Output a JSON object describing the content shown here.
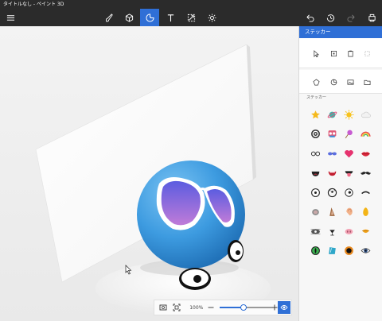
{
  "window": {
    "title": "タイトルなし - ペイント 3D"
  },
  "toolbar": {
    "left": [
      {
        "name": "menu-icon"
      }
    ],
    "tools": [
      {
        "name": "brushes-icon",
        "active": false
      },
      {
        "name": "3d-shapes-icon",
        "active": false
      },
      {
        "name": "stickers-icon",
        "active": true
      },
      {
        "name": "text-icon",
        "active": false
      },
      {
        "name": "effects-icon",
        "active": false
      },
      {
        "name": "canvas-icon",
        "active": false
      }
    ],
    "right": [
      {
        "name": "undo-icon"
      },
      {
        "name": "history-icon"
      },
      {
        "name": "redo-icon"
      },
      {
        "name": "more-icon"
      }
    ]
  },
  "canvas": {
    "cursor": "arrow-cursor-icon"
  },
  "zoombar": {
    "zoom_label": "100%",
    "zoom_fraction": 0.45,
    "icons": [
      "fit-to-screen-icon",
      "actual-size-icon",
      "zoom-out-icon",
      "zoom-in-icon",
      "pen-icon",
      "view-3d-icon"
    ]
  },
  "panel": {
    "title": "ステッカー",
    "section_label": "ステッカー",
    "modes": [
      "select-arrow-icon",
      "stamp-icon",
      "paste-icon",
      "remove-icon"
    ],
    "categories": [
      "stickers-category-icon",
      "textures-category-icon",
      "custom-image-icon",
      "folder-icon"
    ],
    "stickers": [
      "star-sticker",
      "planet-sticker",
      "sun-sticker",
      "cloud-sticker",
      "target-sticker",
      "colorful-sticker",
      "lollipop-sticker",
      "rainbow-sticker",
      "glasses-sticker",
      "sunglasses-sticker",
      "heart-sticker",
      "lips-sticker",
      "open-mouth-sticker",
      "smile-mouth-sticker",
      "tongue-sticker",
      "mustache-sticker",
      "eye-sticker",
      "eye-round-sticker",
      "eye-side-sticker",
      "eyebrow-sticker",
      "gray-ear-sticker",
      "horse-ear-sticker",
      "human-ear-sticker",
      "yellow-ear-sticker",
      "cat-nose-sticker",
      "dog-nose-sticker",
      "pig-nose-sticker",
      "beak-sticker",
      "green-eye-sticker",
      "blue-eye-sticker",
      "orange-eye-sticker",
      "dark-eye-sticker"
    ]
  },
  "colors": {
    "accent": "#2f6fd6",
    "toolbar": "#2b2b2b",
    "sphere": "#3d9be0"
  }
}
